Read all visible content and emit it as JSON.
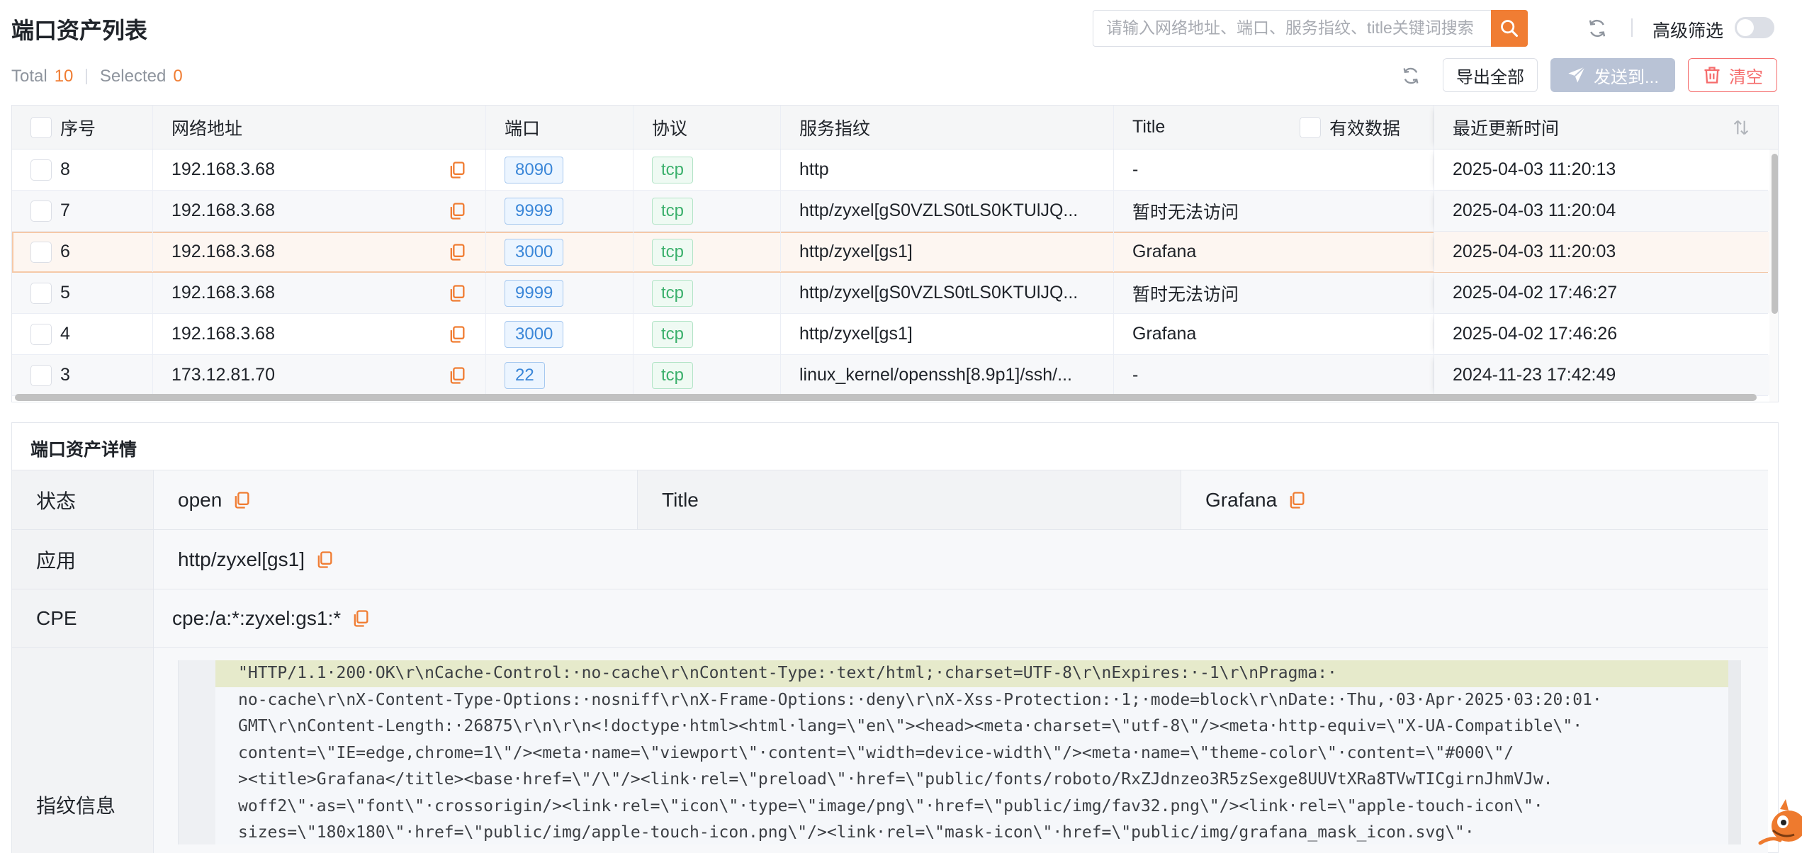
{
  "page": {
    "title": "端口资产列表"
  },
  "search": {
    "placeholder": "请输入网络地址、端口、服务指纹、title关键词搜索",
    "value": ""
  },
  "advanced_filter": {
    "label": "高级筛选",
    "enabled": false
  },
  "stats": {
    "total_label": "Total",
    "total": "10",
    "selected_label": "Selected",
    "selected": "0"
  },
  "toolbar": {
    "export_label": "导出全部",
    "send_label": "发送到...",
    "clear_label": "清空"
  },
  "table": {
    "headers": {
      "index": "序号",
      "address": "网络地址",
      "port": "端口",
      "protocol": "协议",
      "fingerprint": "服务指纹",
      "title": "Title",
      "valid_data": "有效数据",
      "updated": "最近更新时间"
    },
    "rows": [
      {
        "index": "8",
        "address": "192.168.3.68",
        "port": "8090",
        "protocol": "tcp",
        "fingerprint": "http",
        "title": "-",
        "updated": "2025-04-03 11:20:13"
      },
      {
        "index": "7",
        "address": "192.168.3.68",
        "port": "9999",
        "protocol": "tcp",
        "fingerprint": "http/zyxel[gS0VZLS0tLS0KTUlJQ...",
        "title": "暂时无法访问",
        "updated": "2025-04-03 11:20:04"
      },
      {
        "index": "6",
        "address": "192.168.3.68",
        "port": "3000",
        "protocol": "tcp",
        "fingerprint": "http/zyxel[gs1]",
        "title": "Grafana",
        "updated": "2025-04-03 11:20:03"
      },
      {
        "index": "5",
        "address": "192.168.3.68",
        "port": "9999",
        "protocol": "tcp",
        "fingerprint": "http/zyxel[gS0VZLS0tLS0KTUlJQ...",
        "title": "暂时无法访问",
        "updated": "2025-04-02 17:46:27"
      },
      {
        "index": "4",
        "address": "192.168.3.68",
        "port": "3000",
        "protocol": "tcp",
        "fingerprint": "http/zyxel[gs1]",
        "title": "Grafana",
        "updated": "2025-04-02 17:46:26"
      },
      {
        "index": "3",
        "address": "173.12.81.70",
        "port": "22",
        "protocol": "tcp",
        "fingerprint": "linux_kernel/openssh[8.9p1]/ssh/...",
        "title": "-",
        "updated": "2024-11-23 17:42:49"
      }
    ]
  },
  "detail": {
    "title": "端口资产详情",
    "status_label": "状态",
    "status_value": "open",
    "title_label": "Title",
    "title_value": "Grafana",
    "app_label": "应用",
    "app_value": "http/zyxel[gs1]",
    "cpe_label": "CPE",
    "cpe_value": "cpe:/a:*:zyxel:gs1:*",
    "fingerprint_label": "指纹信息",
    "fingerprint_lines": [
      "\"HTTP/1.1·200·OK\\r\\nCache-Control:·no-cache\\r\\nContent-Type:·text/html;·charset=UTF-8\\r\\nExpires:·-1\\r\\nPragma:·",
      "no-cache\\r\\nX-Content-Type-Options:·nosniff\\r\\nX-Frame-Options:·deny\\r\\nX-Xss-Protection:·1;·mode=block\\r\\nDate:·Thu,·03·Apr·2025·03:20:01·",
      "GMT\\r\\nContent-Length:·26875\\r\\n\\r\\n<!doctype·html><html·lang=\\\"en\\\"><head><meta·charset=\\\"utf-8\\\"/><meta·http-equiv=\\\"X-UA-Compatible\\\"·",
      "content=\\\"IE=edge,chrome=1\\\"/><meta·name=\\\"viewport\\\"·content=\\\"width=device-width\\\"/><meta·name=\\\"theme-color\\\"·content=\\\"#000\\\"/",
      "><title>Grafana</title><base·href=\\\"/\\\"/><link·rel=\\\"preload\\\"·href=\\\"public/fonts/roboto/RxZJdnzeo3R5zSexge8UUVtXRa8TVwTICgirnJhmVJw.",
      "woff2\\\"·as=\\\"font\\\"·crossorigin/><link·rel=\\\"icon\\\"·type=\\\"image/png\\\"·href=\\\"public/img/fav32.png\\\"/><link·rel=\\\"apple-touch-icon\\\"·",
      "sizes=\\\"180x180\\\"·href=\\\"public/img/apple-touch-icon.png\\\"/><link·rel=\\\"mask-icon\\\"·href=\\\"public/img/grafana_mask_icon.svg\\\"·"
    ]
  },
  "colors": {
    "accent": "#f07d33",
    "port_tag": "#3a86d8",
    "proto_tag": "#3bb06c",
    "danger": "#f56c6c",
    "send_disabled": "#b9c3d6"
  }
}
